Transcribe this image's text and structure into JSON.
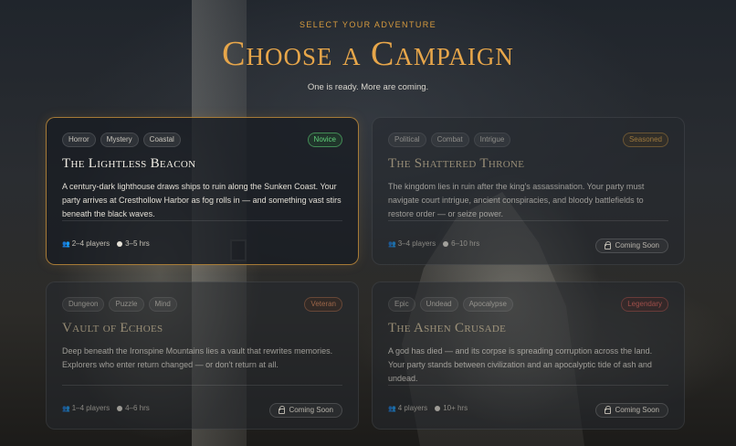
{
  "header": {
    "eyebrow": "SELECT YOUR ADVENTURE",
    "title": "Choose a Campaign",
    "subtitle": "One is ready. More are coming."
  },
  "campaigns": [
    {
      "tags": [
        "Horror",
        "Mystery",
        "Coastal"
      ],
      "difficulty": "Novice",
      "title": "The Lightless Beacon",
      "description": "A century-dark lighthouse draws ships to ruin along the Sunken Coast. Your party arrives at Cresthollow Harbor as fog rolls in — and something vast stirs beneath the black waves.",
      "players": "2–4 players",
      "duration": "3–5 hrs",
      "status": "available"
    },
    {
      "tags": [
        "Political",
        "Combat",
        "Intrigue"
      ],
      "difficulty": "Seasoned",
      "title": "The Shattered Throne",
      "description": "The kingdom lies in ruin after the king's assassination. Your party must navigate court intrigue, ancient conspiracies, and bloody battlefields to restore order — or seize power.",
      "players": "3–4 players",
      "duration": "6–10 hrs",
      "status_label": "Coming Soon"
    },
    {
      "tags": [
        "Dungeon",
        "Puzzle",
        "Mind"
      ],
      "difficulty": "Veteran",
      "title": "Vault of Echoes",
      "description": "Deep beneath the Ironspine Mountains lies a vault that rewrites memories. Explorers who enter return changed — or don't return at all.",
      "players": "1–4 players",
      "duration": "4–6 hrs",
      "status_label": "Coming Soon"
    },
    {
      "tags": [
        "Epic",
        "Undead",
        "Apocalypse"
      ],
      "difficulty": "Legendary",
      "title": "The Ashen Crusade",
      "description": "A god has died — and its corpse is spreading corruption across the land. Your party stands between civilization and an apocalyptic tide of ash and undead.",
      "players": "4 players",
      "duration": "10+ hrs",
      "status_label": "Coming Soon"
    }
  ],
  "colors": {
    "accent": "#e7a64a",
    "novice": "#5fd07a",
    "seasoned": "#e0a445",
    "veteran": "#e38a5a",
    "legendary": "#e3635a"
  },
  "icons": {
    "players": "players-icon",
    "duration": "clock-icon",
    "locked": "lock-icon"
  }
}
